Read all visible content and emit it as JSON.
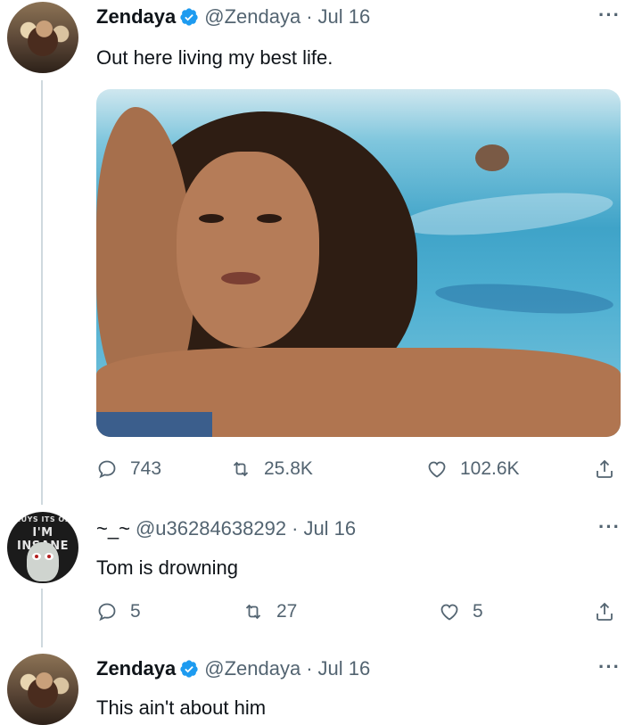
{
  "tweets": [
    {
      "name": "Zendaya",
      "handle": "@Zendaya",
      "date": "Jul 16",
      "text": "Out here living my best life.",
      "has_photo": true,
      "replies": "743",
      "retweets": "25.8K",
      "likes": "102.6K"
    },
    {
      "name": "~_~",
      "handle": "@u36284638292",
      "date": "Jul 16",
      "text": "Tom is drowning",
      "avatar_text_top": "GUYS ITS OK",
      "avatar_text": "I'M INSANE",
      "replies": "5",
      "retweets": "27",
      "likes": "5"
    },
    {
      "name": "Zendaya",
      "handle": "@Zendaya",
      "date": "Jul 16",
      "text": "This ain't about him"
    }
  ],
  "separator": "·",
  "more_label": "···",
  "colors": {
    "verified": "#1d9bf0",
    "secondary_text": "#536471",
    "thread_line": "#cfd9de"
  },
  "icons": [
    "verified-badge-icon",
    "more-icon",
    "reply-icon",
    "retweet-icon",
    "like-icon",
    "share-icon"
  ]
}
